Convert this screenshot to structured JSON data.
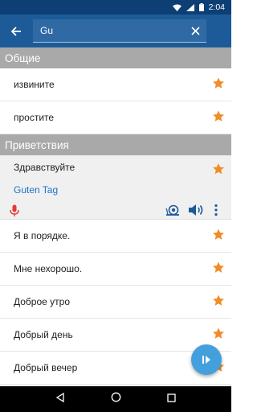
{
  "status_bar": {
    "time": "2:04"
  },
  "search": {
    "value": "Gu"
  },
  "sections": [
    {
      "title": "Общие",
      "items": [
        "извините",
        "простите"
      ]
    },
    {
      "title": "Приветствия"
    }
  ],
  "expanded_item": {
    "text": "Здравствуйте",
    "translation": "Guten Tag"
  },
  "greetings_items": [
    "Я в порядке.",
    "Мне нехорошо.",
    "Доброе утро",
    "Добрый день",
    "Добрый вечер"
  ],
  "colors": {
    "accent": "#1c5b98",
    "star": "#f28c28",
    "translation": "#1a73c8",
    "mic": "#e53935",
    "fab": "#43a0dd"
  },
  "icons": [
    "back-arrow-icon",
    "clear-icon",
    "star-icon",
    "microphone-icon",
    "snail-icon",
    "speaker-icon",
    "more-vert-icon",
    "play-icon"
  ]
}
